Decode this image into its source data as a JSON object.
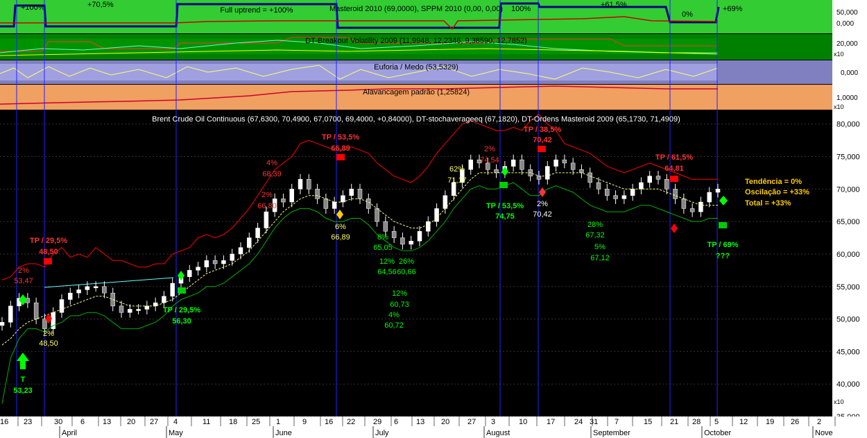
{
  "panels": {
    "masteroid": {
      "title": "Masteroid 2010 (69,0000), SPPM 2010 (0,00, 0,00)",
      "note": "Full uptrend = +100%",
      "labels": [
        "+100%",
        "+70,5%",
        "100%",
        "+61,5%",
        "0%",
        "+69%"
      ],
      "scale": [
        "50,000",
        "0,000"
      ]
    },
    "breakout": {
      "title": "DT-Breakout Volatility 2009 (11,9948, 12,2346, 9,38590, 12,7852)",
      "scale": [
        "20,000"
      ],
      "multiplier": "x10"
    },
    "euforia": {
      "title": "Euforia / Medo (53,5329)",
      "scale": [
        "0,000"
      ]
    },
    "alavancagem": {
      "title": "Alavancagem padrão (1,25824)",
      "scale": [
        "1,0000"
      ],
      "multiplier": "x10"
    },
    "main": {
      "title": "Brent Crude Oil Continuous (67,6300, 70,4900, 67,0700, 69,4000, +0,84000), DT-stochaverageeq (67,1820), DT-Ordens Masteroid 2009 (65,1730, 71,4909)",
      "multiplier": "x10",
      "summary": [
        "Tendência = 0%",
        "Oscilação = +33%",
        "Total = +33%"
      ]
    }
  },
  "annotations": [
    {
      "text": "2%",
      "color": "red"
    },
    {
      "text": "53,47",
      "color": "red"
    },
    {
      "text": "TP / 29,5%",
      "color": "red"
    },
    {
      "text": "48,50",
      "color": "red"
    },
    {
      "text": "2%",
      "color": "yellow"
    },
    {
      "text": "48,50",
      "color": "yellow"
    },
    {
      "text": "T",
      "color": "green"
    },
    {
      "text": "53,23",
      "color": "green"
    },
    {
      "text": "TP / 29,5%",
      "color": "green"
    },
    {
      "text": "56,30",
      "color": "green"
    },
    {
      "text": "4%",
      "color": "red"
    },
    {
      "text": "68,39",
      "color": "red"
    },
    {
      "text": "2%",
      "color": "red"
    },
    {
      "text": "66,80",
      "color": "red"
    },
    {
      "text": "TP / 53,5%",
      "color": "red"
    },
    {
      "text": "66,89",
      "color": "red"
    },
    {
      "text": "6%",
      "color": "yellow"
    },
    {
      "text": "66,89",
      "color": "yellow"
    },
    {
      "text": "8%",
      "color": "green"
    },
    {
      "text": "65,05",
      "color": "green"
    },
    {
      "text": "12%",
      "color": "green"
    },
    {
      "text": "64,56",
      "color": "green"
    },
    {
      "text": "26%",
      "color": "green"
    },
    {
      "text": "60,66",
      "color": "green"
    },
    {
      "text": "12%",
      "color": "green"
    },
    {
      "text": "60,73",
      "color": "green"
    },
    {
      "text": "4%",
      "color": "green"
    },
    {
      "text": "60,72",
      "color": "green"
    },
    {
      "text": "62%",
      "color": "yellow"
    },
    {
      "text": "71,17",
      "color": "yellow"
    },
    {
      "text": "2%",
      "color": "red"
    },
    {
      "text": "74,54",
      "color": "red"
    },
    {
      "text": "TP / 53,5%",
      "color": "green"
    },
    {
      "text": "74,75",
      "color": "green"
    },
    {
      "text": "TP / 38,5%",
      "color": "red"
    },
    {
      "text": "70,42",
      "color": "red"
    },
    {
      "text": "2%",
      "color": "white"
    },
    {
      "text": "70,42",
      "color": "white"
    },
    {
      "text": "28%",
      "color": "green"
    },
    {
      "text": "67,32",
      "color": "green"
    },
    {
      "text": "5%",
      "color": "green"
    },
    {
      "text": "67,12",
      "color": "green"
    },
    {
      "text": "TP / 61,5%",
      "color": "red"
    },
    {
      "text": "64,81",
      "color": "red"
    },
    {
      "text": "TP / 69%",
      "color": "green"
    },
    {
      "text": "???",
      "color": "green"
    }
  ],
  "chart_data": {
    "type": "line",
    "title": "Brent Crude Oil Continuous (67,6300, 70,4900, 67,0700, 69,4000, +0,84000), DT-stochaverageeq (67,1820), DT-Ordens Masteroid 2009 (65,1730, 71,4909)",
    "xlabel": "",
    "ylabel": "",
    "ylim": [
      35,
      82
    ],
    "yticks": [
      35,
      40,
      45,
      50,
      55,
      60,
      65,
      70,
      75,
      80
    ],
    "yticklabels": [
      "35,000",
      "40,000",
      "45,000",
      "50,000",
      "55,000",
      "60,000",
      "65,000",
      "70,000",
      "75,000",
      "80,000"
    ],
    "x_day_labels": [
      "16",
      "23",
      "30",
      "6",
      "13",
      "20",
      "27",
      "4",
      "11",
      "18",
      "25",
      "1",
      "9",
      "16",
      "22",
      "29",
      "6",
      "13",
      "20",
      "27",
      "3",
      "10",
      "17",
      "24",
      "31",
      "7",
      "15",
      "21",
      "28",
      "5",
      "12",
      "19",
      "26",
      "2"
    ],
    "x_month_labels": [
      "April",
      "May",
      "June",
      "July",
      "August",
      "September",
      "October",
      "Nove"
    ],
    "series": [
      {
        "name": "Brent Crude Oil Continuous",
        "color": "#ffffff",
        "values": [
          49.5,
          52,
          53.2,
          52.5,
          50,
          48.5,
          51,
          53,
          54,
          54.5,
          55,
          55,
          54,
          52,
          51,
          51.5,
          51.5,
          52,
          52.5,
          53.5,
          55.5,
          56.5,
          57.5,
          58,
          59,
          58.5,
          59,
          60,
          61,
          62.5,
          64,
          66.5,
          68.5,
          68,
          70,
          71.5,
          70,
          68.5,
          67,
          68,
          69,
          70,
          68.5,
          67,
          65,
          63.5,
          62.5,
          61.5,
          62,
          63.5,
          65,
          67,
          69,
          71,
          73,
          74.5,
          74,
          73,
          72.5,
          73.5,
          74.5,
          73,
          72,
          71.5,
          73.5,
          74.5,
          74,
          73,
          72.5,
          71,
          70,
          69,
          68.5,
          69,
          70,
          71,
          72,
          71.5,
          70,
          68.5,
          67,
          66.5,
          68,
          69.5,
          70
        ]
      },
      {
        "name": "DT-stochaverageeq",
        "color": "#ffff80",
        "values": [
          46,
          47,
          48.5,
          49.5,
          50,
          50.5,
          51,
          51.5,
          52,
          52.5,
          53,
          53.5,
          53.5,
          53,
          52.5,
          52,
          52,
          52,
          52,
          52.5,
          53,
          54,
          55,
          56,
          57,
          57.5,
          58,
          58.5,
          59.5,
          60.5,
          62,
          63.5,
          65,
          66.5,
          67.5,
          68.5,
          69,
          69,
          68.5,
          68,
          68,
          68.5,
          68.5,
          68,
          67,
          66,
          65,
          64.5,
          64,
          64,
          64.5,
          65.5,
          67,
          68.5,
          70,
          71.5,
          72.5,
          72.5,
          72.5,
          72.5,
          72.5,
          72.5,
          72.5,
          72,
          72,
          72.5,
          72.5,
          72.5,
          72.5,
          72,
          71.5,
          71,
          70.5,
          70,
          70,
          70,
          70,
          70,
          69.5,
          69,
          68.5,
          68,
          67.5,
          67.5,
          67.5
        ]
      },
      {
        "name": "DT-Ordens Masteroid 2009 (upper)",
        "color": "#ff0000",
        "values": [
          56,
          56.5,
          58,
          58.5,
          58.5,
          58,
          60,
          61,
          59.5,
          60,
          59.5,
          61,
          60,
          59,
          59,
          58.5,
          58,
          58,
          58.5,
          58.5,
          60,
          60.5,
          61,
          62.5,
          63,
          62.5,
          63,
          64,
          65.5,
          67,
          69,
          71,
          73,
          74,
          75,
          77,
          77.5,
          77,
          76.5,
          76,
          76,
          76.5,
          76,
          75.5,
          74,
          73,
          72,
          71.5,
          71,
          72,
          73.5,
          75.5,
          77,
          78.5,
          80,
          80.5,
          80,
          79.5,
          79,
          79,
          79.5,
          79,
          80.5,
          81.5,
          80,
          79,
          77,
          76.5,
          76,
          75.5,
          74.5,
          73.5,
          73,
          72.5,
          73,
          73.5,
          74,
          73.5,
          73,
          72.5,
          72,
          71.5,
          71.5,
          71.5,
          71.5
        ]
      },
      {
        "name": "DT-Ordens Masteroid 2009 (lower)",
        "color": "#00b000",
        "values": [
          37,
          44,
          47,
          48.5,
          48.5,
          48,
          49,
          49.5,
          50.5,
          50.5,
          51,
          51,
          50.5,
          49.5,
          48.5,
          48.5,
          48.5,
          49,
          49.5,
          50.5,
          52,
          53,
          53.5,
          54,
          55,
          55,
          55.5,
          56.5,
          57.5,
          58.5,
          60,
          62,
          64,
          65.5,
          66.5,
          67,
          67,
          66.5,
          65.5,
          65,
          65,
          65.5,
          65.5,
          64.5,
          63,
          62,
          61,
          60.5,
          60.5,
          61,
          62,
          63.5,
          65,
          67,
          68.5,
          70,
          70.5,
          70,
          70,
          70.5,
          71,
          70,
          69,
          69,
          70,
          70.5,
          70,
          69.5,
          68.5,
          67.5,
          67,
          66.5,
          66.5,
          66.5,
          67,
          67.5,
          67.5,
          67,
          66.5,
          66,
          65.5,
          65,
          65,
          65.5,
          65.5
        ]
      }
    ]
  }
}
